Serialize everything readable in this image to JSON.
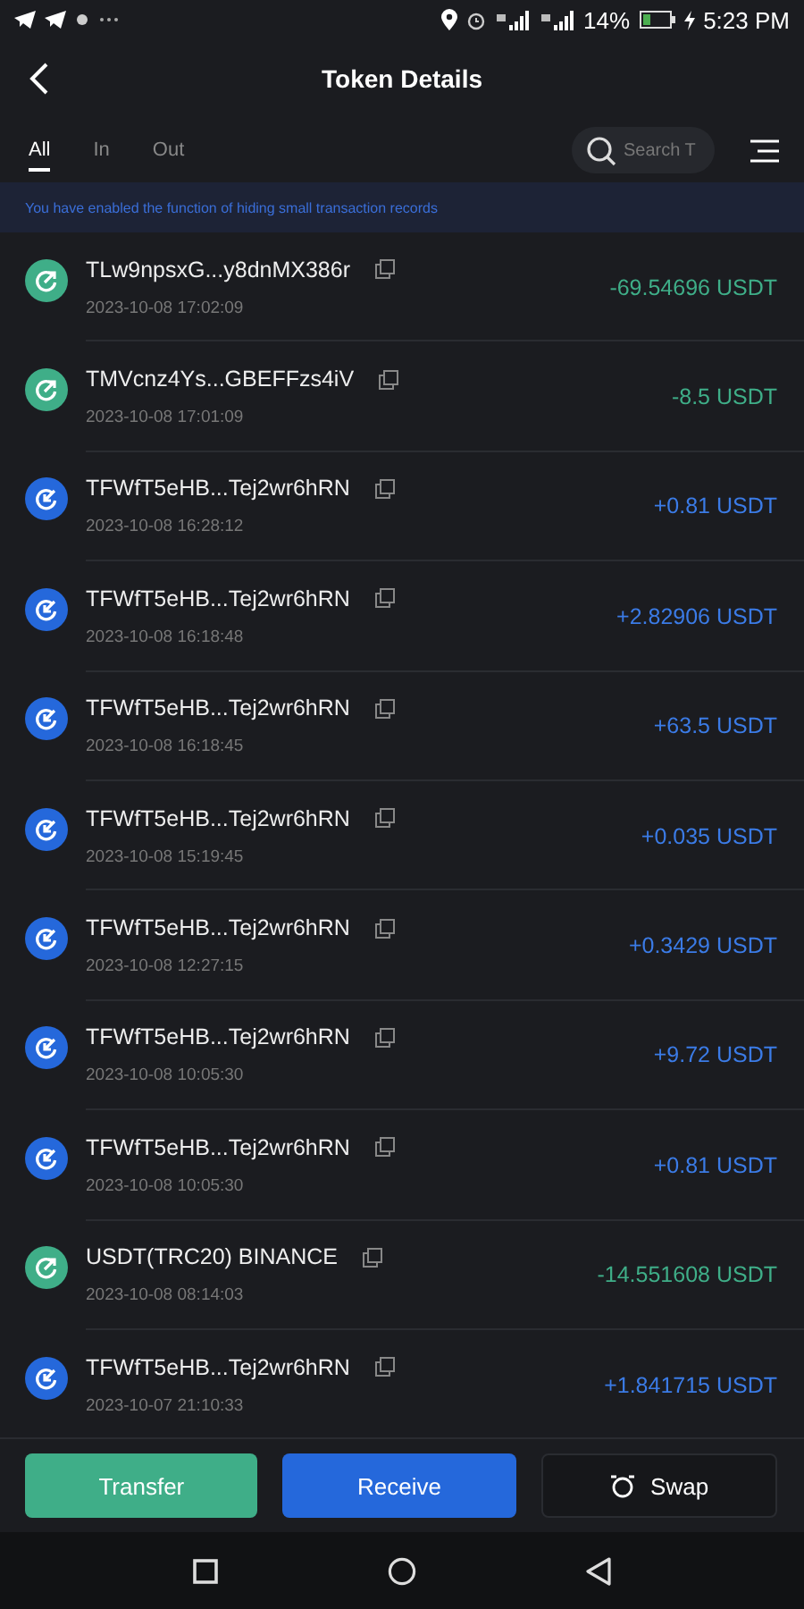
{
  "status_bar": {
    "battery": "14%",
    "time": "5:23 PM"
  },
  "header": {
    "title": "Token Details"
  },
  "tabs": [
    {
      "label": "All",
      "selected": true
    },
    {
      "label": "In",
      "selected": false
    },
    {
      "label": "Out",
      "selected": false
    }
  ],
  "search": {
    "placeholder": "Search T"
  },
  "notice": "You have enabled the function of hiding small transaction records",
  "transactions": [
    {
      "kind": "out",
      "address": "TLw9npsxG...y8dnMX386r",
      "time": "2023-10-08 17:02:09",
      "amount": "-69.54696 USDT"
    },
    {
      "kind": "out",
      "address": "TMVcnz4Ys...GBEFFzs4iV",
      "time": "2023-10-08 17:01:09",
      "amount": "-8.5 USDT"
    },
    {
      "kind": "in",
      "address": "TFWfT5eHB...Tej2wr6hRN",
      "time": "2023-10-08 16:28:12",
      "amount": "+0.81 USDT"
    },
    {
      "kind": "in",
      "address": "TFWfT5eHB...Tej2wr6hRN",
      "time": "2023-10-08 16:18:48",
      "amount": "+2.82906 USDT"
    },
    {
      "kind": "in",
      "address": "TFWfT5eHB...Tej2wr6hRN",
      "time": "2023-10-08 16:18:45",
      "amount": "+63.5 USDT"
    },
    {
      "kind": "in",
      "address": "TFWfT5eHB...Tej2wr6hRN",
      "time": "2023-10-08 15:19:45",
      "amount": "+0.035 USDT"
    },
    {
      "kind": "in",
      "address": "TFWfT5eHB...Tej2wr6hRN",
      "time": "2023-10-08 12:27:15",
      "amount": "+0.3429 USDT"
    },
    {
      "kind": "in",
      "address": "TFWfT5eHB...Tej2wr6hRN",
      "time": "2023-10-08 10:05:30",
      "amount": "+9.72 USDT"
    },
    {
      "kind": "in",
      "address": "TFWfT5eHB...Tej2wr6hRN",
      "time": "2023-10-08 10:05:30",
      "amount": "+0.81 USDT"
    },
    {
      "kind": "out",
      "address": "USDT(TRC20) BINANCE",
      "time": "2023-10-08 08:14:03",
      "amount": "-14.551608 USDT"
    },
    {
      "kind": "in",
      "address": "TFWfT5eHB...Tej2wr6hRN",
      "time": "2023-10-07 21:10:33",
      "amount": "+1.841715 USDT"
    }
  ],
  "actions": {
    "transfer": "Transfer",
    "receive": "Receive",
    "swap": "Swap"
  }
}
